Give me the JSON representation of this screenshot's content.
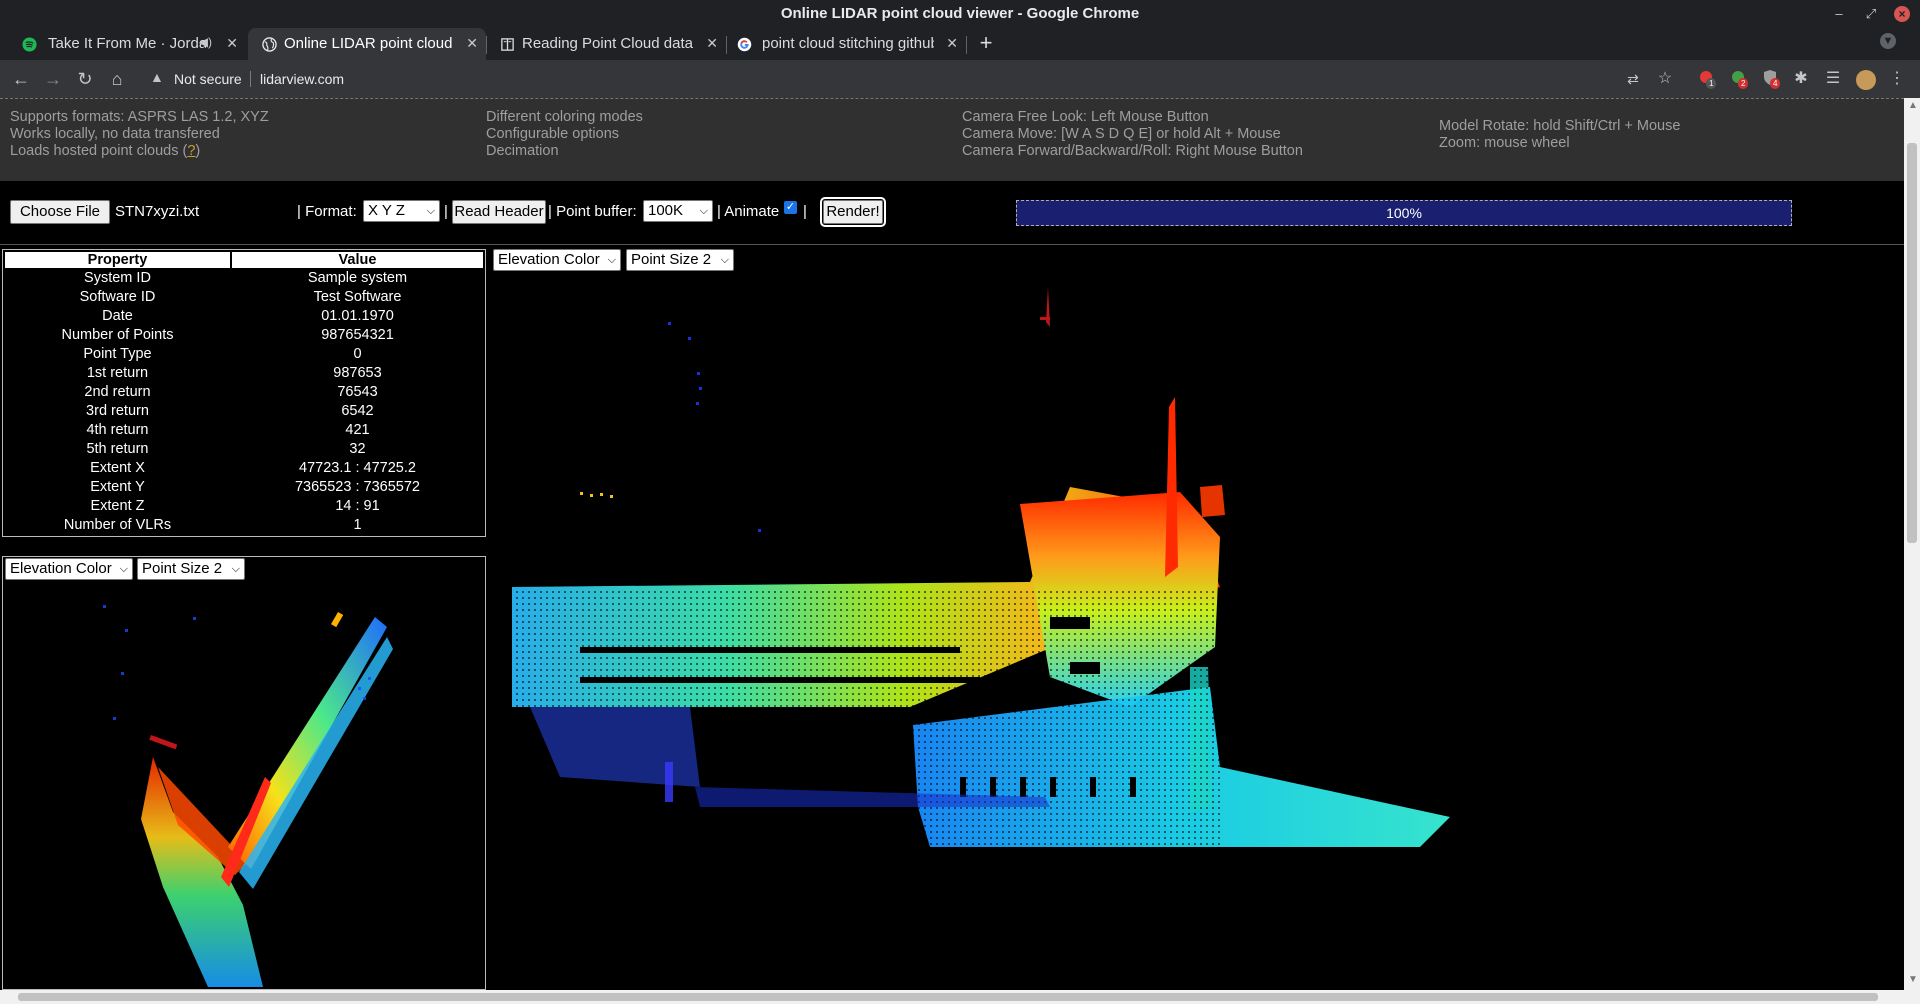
{
  "window": {
    "title": "Online LIDAR point cloud viewer - Google Chrome"
  },
  "tabs": [
    {
      "label": "Take It From Me · Jordan",
      "icon": "spotify-icon",
      "active": false
    },
    {
      "label": "Online LIDAR point cloud viewer",
      "icon": "globe-icon",
      "active": true
    },
    {
      "label": "Reading Point Cloud data",
      "icon": "book-icon",
      "active": false
    },
    {
      "label": "point cloud stitching github",
      "icon": "google-icon",
      "active": false
    }
  ],
  "omnibox": {
    "security": "Not secure",
    "url": "lidarview.com"
  },
  "extensions": {
    "badge1": "1",
    "badge2": "2",
    "badge3": "4"
  },
  "info": {
    "col1": [
      "Supports formats: ASPRS LAS 1.2, XYZ",
      "Works locally, no data transfered",
      "Loads hosted point clouds ("
    ],
    "col1_link": "?",
    "col1_end": ")",
    "col2": [
      "Different coloring modes",
      "Configurable options",
      "Decimation"
    ],
    "col3": [
      "Camera Free Look: Left Mouse Button",
      "Camera Move: [W A S D Q E] or hold Alt + Mouse",
      "Camera Forward/Backward/Roll: Right Mouse Button"
    ],
    "col4": [
      "Model Rotate: hold Shift/Ctrl + Mouse",
      "Zoom: mouse wheel"
    ]
  },
  "controls": {
    "choose_file": "Choose File",
    "file_name": "STN7xyzi.txt",
    "format_label": "| Format:",
    "format_value": "X Y Z",
    "read_header": "Read Header",
    "buffer_label": "| Point buffer:",
    "buffer_value": "100K",
    "animate_label": "| Animate",
    "animate_checked": true,
    "sep": "|",
    "render": "Render!",
    "progress": "100%",
    "progress_fraction": 1.0
  },
  "properties": {
    "headers": [
      "Property",
      "Value"
    ],
    "rows": [
      [
        "System ID",
        "Sample system"
      ],
      [
        "Software ID",
        "Test Software"
      ],
      [
        "Date",
        "01.01.1970"
      ],
      [
        "Number of Points",
        "987654321"
      ],
      [
        "Point Type",
        "0"
      ],
      [
        "1st return",
        "987653"
      ],
      [
        "2nd return",
        "76543"
      ],
      [
        "3rd return",
        "6542"
      ],
      [
        "4th return",
        "421"
      ],
      [
        "5th return",
        "32"
      ],
      [
        "Extent X",
        "47723.1 : 47725.2"
      ],
      [
        "Extent Y",
        "7365523 : 7365572"
      ],
      [
        "Extent Z",
        "14 : 91"
      ],
      [
        "Number of VLRs",
        "1"
      ]
    ]
  },
  "mini_view": {
    "color_mode": "Elevation Color",
    "point_size": "Point Size 2"
  },
  "main_view": {
    "color_mode": "Elevation Color",
    "point_size": "Point Size 2"
  },
  "colors": {
    "chrome_dark": "#202124",
    "toolbar": "#35363a",
    "progress_fill": "#1a1f70",
    "checkbox": "#1a73e8"
  }
}
